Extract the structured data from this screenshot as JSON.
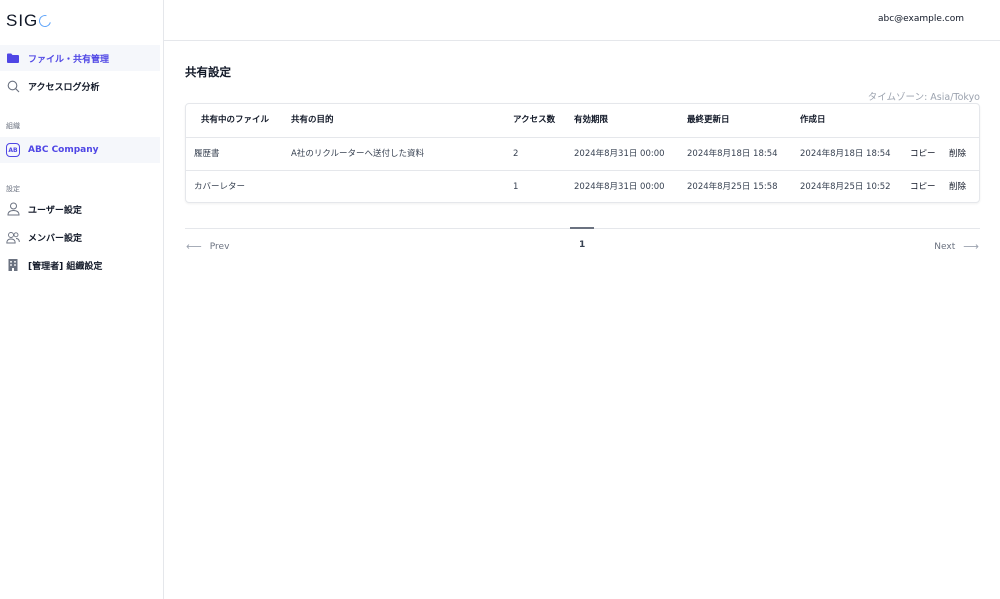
{
  "app": {
    "logo_text": "SIG"
  },
  "sidebar": {
    "items_top": [
      {
        "label": "ファイル・共有管理",
        "icon": "folder-icon"
      },
      {
        "label": "アクセスログ分析",
        "icon": "search-icon"
      }
    ],
    "org_section_label": "組織",
    "org": {
      "badge": "AB",
      "name": "ABC Company"
    },
    "settings_section_label": "設定",
    "settings_items": [
      {
        "label": "ユーザー設定",
        "icon": "user-icon"
      },
      {
        "label": "メンバー設定",
        "icon": "users-icon"
      },
      {
        "label": "[管理者] 組織設定",
        "icon": "building-icon"
      }
    ],
    "accent_color": "#4f46e5"
  },
  "header": {
    "user_email": "abc@example.com"
  },
  "main": {
    "title": "共有設定",
    "timezone": "タイムゾーン: Asia/Tokyo",
    "table": {
      "columns": [
        "共有中のファイル",
        "共有の目的",
        "アクセス数",
        "有効期限",
        "最終更新日",
        "作成日"
      ],
      "rows": [
        {
          "file": "履歴書",
          "purpose": "A社のリクルーターへ送付した資料",
          "count": "2",
          "expiry": "2024年8月31日 00:00",
          "updated": "2024年8月18日 18:54",
          "created": "2024年8月18日 18:54",
          "copy": "コピー",
          "delete": "削除"
        },
        {
          "file": "カバーレター",
          "purpose": "",
          "count": "1",
          "expiry": "2024年8月31日 00:00",
          "updated": "2024年8月25日 15:58",
          "created": "2024年8月25日 10:52",
          "copy": "コピー",
          "delete": "削除"
        }
      ]
    },
    "pagination": {
      "prev": "Prev",
      "next": "Next",
      "current_page": "1"
    }
  }
}
